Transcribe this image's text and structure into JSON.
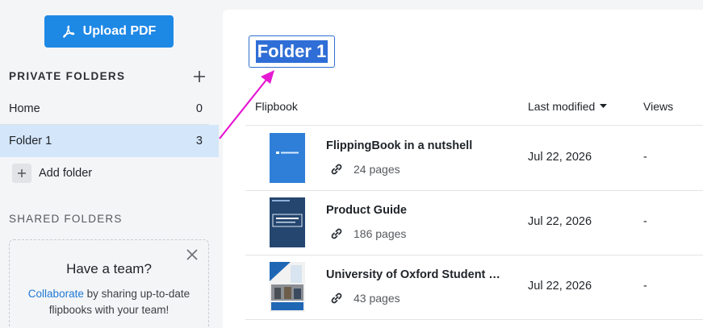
{
  "sidebar": {
    "upload_label": "Upload PDF",
    "private_folders_title": "PRIVATE FOLDERS",
    "folders": [
      {
        "name": "Home",
        "count": "0"
      },
      {
        "name": "Folder 1",
        "count": "3"
      }
    ],
    "add_folder_label": "Add folder",
    "shared_folders_title": "SHARED FOLDERS",
    "team_card": {
      "title": "Have a team?",
      "link_text": "Collaborate",
      "text_rest": " by sharing up-to-date flipbooks with your team!"
    }
  },
  "main": {
    "folder_title": "Folder 1",
    "columns": {
      "flipbook": "Flipbook",
      "last_modified": "Last modified",
      "views": "Views"
    },
    "rows": [
      {
        "title": "FlippingBook in a nutshell",
        "pages": "24 pages",
        "date": "Jul 22, 2026",
        "views": "-"
      },
      {
        "title": "Product Guide",
        "pages": "186 pages",
        "date": "Jul 22, 2026",
        "views": "-"
      },
      {
        "title": "University of Oxford Student Handbook",
        "pages": "43 pages",
        "date": "Jul 22, 2026",
        "views": "-"
      }
    ]
  },
  "colors": {
    "accent": "#1e88e5",
    "selected_folder_bg": "#d4e6f9",
    "arrow": "#e619d2"
  }
}
